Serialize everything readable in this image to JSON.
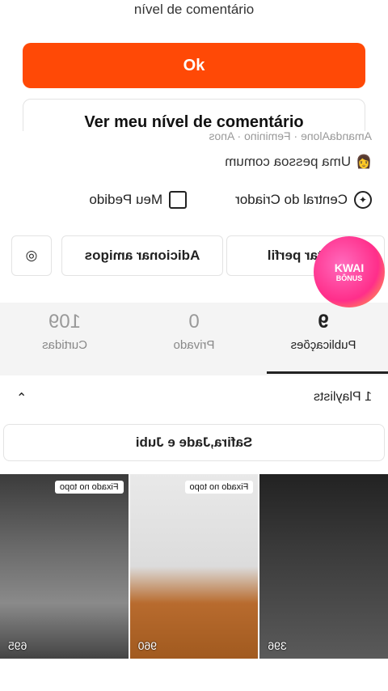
{
  "top_message": "nível de comentário",
  "ok_label": "Ok",
  "level_label": "Ver meu nível de comentário",
  "profile": {
    "username_line": "AmandaAlone · Feminino · Anos",
    "common_label": "Uma pessoa comum",
    "creator_center_label": "Central do Criador",
    "my_order_label": "Meu Pedido",
    "edit_profile_label": "Editar perfil",
    "add_friends_label": "Adicionar amigos"
  },
  "stats": [
    {
      "value": "9",
      "label": "Publicações"
    },
    {
      "value": "0",
      "label": "Privado"
    },
    {
      "value": "109",
      "label": "Curtidas"
    }
  ],
  "playlist": {
    "header_label": "1 Playlists",
    "pill_label": "Safira,Jade e Jubi"
  },
  "thumbs": [
    {
      "count": "396",
      "pin": ""
    },
    {
      "count": "960",
      "pin": "Fixado no topo"
    },
    {
      "count": "695",
      "pin": "Fixado no topo"
    }
  ],
  "promo": {
    "line1": "KWAI",
    "line2": "BÔNUS"
  }
}
